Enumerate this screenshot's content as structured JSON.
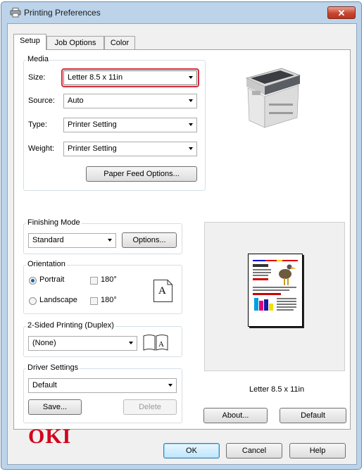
{
  "window": {
    "title": "Printing Preferences",
    "close_label": "✕"
  },
  "tabs": [
    {
      "label": "Setup"
    },
    {
      "label": "Job Options"
    },
    {
      "label": "Color"
    }
  ],
  "media": {
    "group_label": "Media",
    "size_label": "Size:",
    "size_value": "Letter 8.5 x 11in",
    "source_label": "Source:",
    "source_value": "Auto",
    "type_label": "Type:",
    "type_value": "Printer Setting",
    "weight_label": "Weight:",
    "weight_value": "Printer Setting",
    "paper_feed_button": "Paper Feed Options..."
  },
  "finishing": {
    "group_label": "Finishing Mode",
    "value": "Standard",
    "options_button": "Options..."
  },
  "orientation": {
    "group_label": "Orientation",
    "portrait_label": "Portrait",
    "landscape_label": "Landscape",
    "rotate_label_1": "180°",
    "rotate_label_2": "180°",
    "portrait_selected": true,
    "icon_letter": "A"
  },
  "duplex": {
    "group_label": "2-Sided Printing (Duplex)",
    "value": "(None)"
  },
  "driver": {
    "group_label": "Driver Settings",
    "value": "Default",
    "save_button": "Save...",
    "delete_button": "Delete"
  },
  "preview": {
    "caption": "Letter 8.5 x 11in"
  },
  "brand": {
    "logo_text": "OKI",
    "color": "#d0021b"
  },
  "buttons": {
    "about": "About...",
    "default": "Default",
    "ok": "OK",
    "cancel": "Cancel",
    "help": "Help"
  }
}
